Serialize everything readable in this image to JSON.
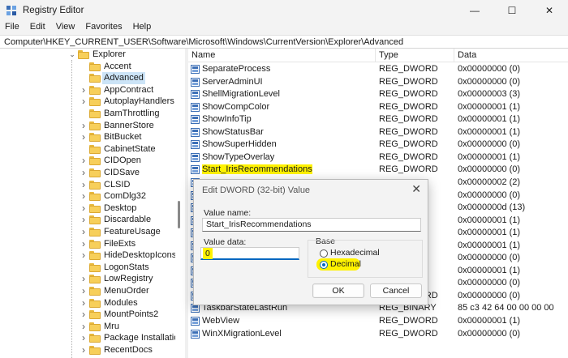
{
  "window": {
    "title": "Registry Editor"
  },
  "menu": [
    "File",
    "Edit",
    "View",
    "Favorites",
    "Help"
  ],
  "address_path": "Computer\\HKEY_CURRENT_USER\\Software\\Microsoft\\Windows\\CurrentVersion\\Explorer\\Advanced",
  "tree": [
    {
      "label": "Explorer",
      "expanded": true,
      "level": 0
    },
    {
      "label": "Accent",
      "level": 1,
      "has_children": false
    },
    {
      "label": "Advanced",
      "level": 1,
      "has_children": false,
      "selected": true
    },
    {
      "label": "AppContract",
      "level": 1,
      "has_children": true
    },
    {
      "label": "AutoplayHandlers",
      "level": 1,
      "has_children": true
    },
    {
      "label": "BamThrottling",
      "level": 1,
      "has_children": false
    },
    {
      "label": "BannerStore",
      "level": 1,
      "has_children": true
    },
    {
      "label": "BitBucket",
      "level": 1,
      "has_children": true
    },
    {
      "label": "CabinetState",
      "level": 1,
      "has_children": false
    },
    {
      "label": "CIDOpen",
      "level": 1,
      "has_children": true
    },
    {
      "label": "CIDSave",
      "level": 1,
      "has_children": true
    },
    {
      "label": "CLSID",
      "level": 1,
      "has_children": true
    },
    {
      "label": "ComDlg32",
      "level": 1,
      "has_children": true
    },
    {
      "label": "Desktop",
      "level": 1,
      "has_children": true
    },
    {
      "label": "Discardable",
      "level": 1,
      "has_children": true
    },
    {
      "label": "FeatureUsage",
      "level": 1,
      "has_children": true
    },
    {
      "label": "FileExts",
      "level": 1,
      "has_children": true
    },
    {
      "label": "HideDesktopIcons",
      "level": 1,
      "has_children": true
    },
    {
      "label": "LogonStats",
      "level": 1,
      "has_children": false
    },
    {
      "label": "LowRegistry",
      "level": 1,
      "has_children": true
    },
    {
      "label": "MenuOrder",
      "level": 1,
      "has_children": true
    },
    {
      "label": "Modules",
      "level": 1,
      "has_children": true
    },
    {
      "label": "MountPoints2",
      "level": 1,
      "has_children": true
    },
    {
      "label": "Mru",
      "level": 1,
      "has_children": true
    },
    {
      "label": "Package Installation",
      "level": 1,
      "has_children": true
    },
    {
      "label": "RecentDocs",
      "level": 1,
      "has_children": true
    }
  ],
  "columns": {
    "name": "Name",
    "type": "Type",
    "data": "Data"
  },
  "values": [
    {
      "name": "SeparateProcess",
      "type": "REG_DWORD",
      "data": "0x00000000 (0)"
    },
    {
      "name": "ServerAdminUI",
      "type": "REG_DWORD",
      "data": "0x00000000 (0)"
    },
    {
      "name": "ShellMigrationLevel",
      "type": "REG_DWORD",
      "data": "0x00000003 (3)"
    },
    {
      "name": "ShowCompColor",
      "type": "REG_DWORD",
      "data": "0x00000001 (1)"
    },
    {
      "name": "ShowInfoTip",
      "type": "REG_DWORD",
      "data": "0x00000001 (1)"
    },
    {
      "name": "ShowStatusBar",
      "type": "REG_DWORD",
      "data": "0x00000001 (1)"
    },
    {
      "name": "ShowSuperHidden",
      "type": "REG_DWORD",
      "data": "0x00000000 (0)"
    },
    {
      "name": "ShowTypeOverlay",
      "type": "REG_DWORD",
      "data": "0x00000001 (1)"
    },
    {
      "name": "Start_IrisRecommendations",
      "type": "REG_DWORD",
      "data": "0x00000000 (0)",
      "highlighted": true
    },
    {
      "name": "",
      "type": "",
      "data": "0x00000002 (2)"
    },
    {
      "name": "",
      "type": "",
      "data": "0x00000000 (0)"
    },
    {
      "name": "",
      "type": "",
      "data": "0x0000000d (13)"
    },
    {
      "name": "",
      "type": "",
      "data": "0x00000001 (1)"
    },
    {
      "name": "",
      "type": "",
      "data": "0x00000001 (1)"
    },
    {
      "name": "",
      "type": "",
      "data": "0x00000001 (1)"
    },
    {
      "name": "",
      "type": "",
      "data": "0x00000000 (0)"
    },
    {
      "name": "",
      "type": "",
      "data": "0x00000001 (1)"
    },
    {
      "name": "",
      "type": "",
      "data": "0x00000000 (0)"
    },
    {
      "name": "TaskbarSmallIcons",
      "type": "REG_DWORD",
      "data": "0x00000000 (0)"
    },
    {
      "name": "TaskbarStateLastRun",
      "type": "REG_BINARY",
      "data": "85 c3 42 64 00 00 00 00"
    },
    {
      "name": "WebView",
      "type": "REG_DWORD",
      "data": "0x00000001 (1)"
    },
    {
      "name": "WinXMigrationLevel",
      "type": "REG_DWORD",
      "data": "0x00000000 (0)"
    }
  ],
  "dialog": {
    "title": "Edit DWORD (32-bit) Value",
    "value_name_label": "Value name:",
    "value_name": "Start_IrisRecommendations",
    "value_data_label": "Value data:",
    "value_data": "0",
    "base_label": "Base",
    "hex_label": "Hexadecimal",
    "dec_label": "Decimal",
    "selected_base": "Decimal",
    "ok_label": "OK",
    "cancel_label": "Cancel"
  },
  "colors": {
    "highlight": "#fff200",
    "selection": "#cce4f7",
    "accent": "#0067c0"
  }
}
